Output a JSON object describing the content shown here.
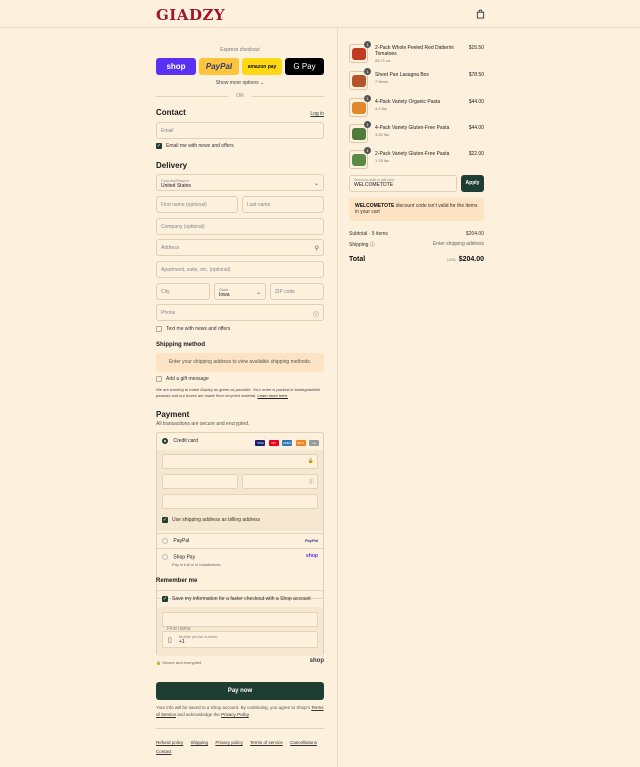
{
  "header": {
    "logo": "GIADZY",
    "bag_icon": "bag-icon"
  },
  "express": {
    "label": "Express checkout",
    "buttons": [
      {
        "label": "shop",
        "color": "#5a31f4"
      },
      {
        "label": "PayPal",
        "color": "#ffc439"
      },
      {
        "label": "amazon pay",
        "color": "#ffd814"
      },
      {
        "label": "G Pay",
        "color": "#000000"
      }
    ],
    "more_options": "Show more options ⌄",
    "or": "OR"
  },
  "contact": {
    "title": "Contact",
    "login": "Log in",
    "email_placeholder": "Email",
    "news_checkbox": "Email me with news and offers"
  },
  "delivery": {
    "title": "Delivery",
    "country_label": "Country/Region",
    "country_value": "United States",
    "first_name": "First name (optional)",
    "last_name": "Last name",
    "company": "Company (optional)",
    "address": "Address",
    "apartment": "Apartment, suite, etc. (optional)",
    "city": "City",
    "state_label": "State",
    "state_value": "Iowa",
    "zip": "ZIP code",
    "phone": "Phone",
    "text_checkbox": "Text me with news and offers"
  },
  "shipping_method": {
    "title": "Shipping method",
    "message": "Enter your shipping address to view available shipping methods.",
    "gift_message": "Add a gift message",
    "note": "We are working to make Giadzy as green as possible. Your order is packed in biodegradable peanuts and our boxes are made from recycled material.",
    "note_link": "Learn more here."
  },
  "payment": {
    "title": "Payment",
    "subtitle": "All transactions are secure and encrypted.",
    "credit_card": "Credit card",
    "card_logos": [
      "VISA",
      "MC",
      "AMEX",
      "DISC",
      "+4"
    ],
    "billing_checkbox": "Use shipping address as billing address",
    "paypal": "PayPal",
    "paypal_logo": "PayPal",
    "shop_pay": "Shop Pay",
    "shop_pay_sub": "Pay in full or in installments",
    "shop_logo": "shop"
  },
  "remember": {
    "title": "Remember me",
    "save_checkbox": "Save my information for a faster checkout with a Shop account",
    "first_name": "First name",
    "mobile_label": "Mobile phone number",
    "mobile_value": "+1",
    "secure": "Secure and encrypted",
    "shop_logo": "shop"
  },
  "pay_now": "Pay now",
  "legal": {
    "text1": "Your info will be saved to a Shop account. By continuing, you agree to Shop’s",
    "tos": "Terms of Service",
    "text2": "and acknowledge the",
    "privacy": "Privacy Policy",
    "end": "."
  },
  "footer": {
    "links": [
      "Refund policy",
      "Shipping",
      "Privacy policy",
      "Terms of service",
      "Cancellations",
      "Contact"
    ]
  },
  "cart": {
    "items": [
      {
        "name": "2-Pack Whole Peeled Red Datterini Tomatoes",
        "sub": "28.71 oz",
        "price": "$15.50",
        "qty": "1",
        "color": "#c23a22"
      },
      {
        "name": "Sheet Pan Lasagna Box",
        "sub": "7 Items",
        "price": "$78.50",
        "qty": "1",
        "color": "#b5532b"
      },
      {
        "name": "4-Pack Variety Organic Pasta",
        "sub": "4.4 lbs",
        "price": "$44.00",
        "qty": "1",
        "color": "#e0892f"
      },
      {
        "name": "4-Pack Variety Gluten-Free Pasta",
        "sub": "3.52 lbs",
        "price": "$44.00",
        "qty": "1",
        "color": "#4f7a3a"
      },
      {
        "name": "2-Pack Variety Gluten-Free Pasta",
        "sub": "1.76 lbs",
        "price": "$22.00",
        "qty": "1",
        "color": "#5c8a45"
      }
    ],
    "discount_label": "Discount code or gift card",
    "discount_value": "WELCOMETOTE",
    "apply": "Apply",
    "error_code": "WELCOMETOTE",
    "error_text": "discount code isn’t valid for the items in your cart",
    "subtotal_label": "Subtotal · 5 items",
    "subtotal_value": "$204.00",
    "shipping_label": "Shipping ⓘ",
    "shipping_value": "Enter shipping address",
    "total_label": "Total",
    "total_currency": "USD",
    "total_value": "$204.00"
  }
}
